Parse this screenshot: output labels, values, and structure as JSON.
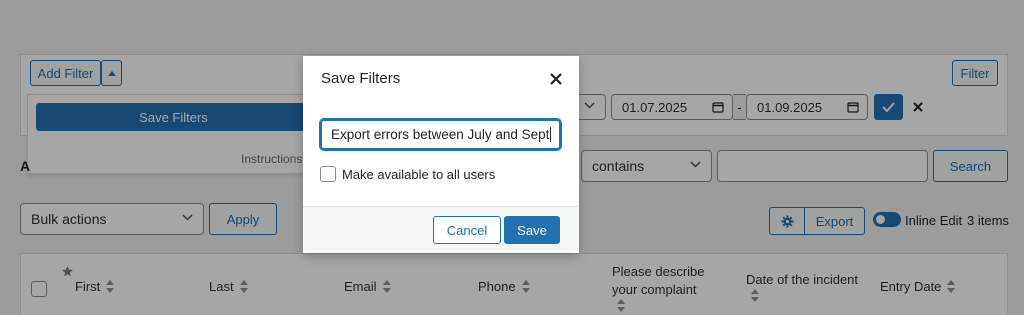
{
  "toolbar": {
    "add_filter_label": "Add Filter",
    "filter_label": "Filter",
    "save_filters_label": "Save Filters",
    "instructions_partial": "Instructions",
    "partial_letter": "A",
    "date_from": "01.07.2025",
    "date_to": "01.09.2025",
    "date_separator": "-"
  },
  "search": {
    "operator": "contains",
    "value": "",
    "button_label": "Search"
  },
  "bulk": {
    "select_value": "Bulk actions",
    "apply_label": "Apply",
    "export_label": "Export",
    "inline_edit_label": "Inline Edit",
    "items_count": "3 items"
  },
  "table": {
    "columns": [
      "First",
      "Last",
      "Email",
      "Phone",
      "Please describe your complaint",
      "Date of the incident",
      "Entry Date"
    ]
  },
  "modal": {
    "title": "Save Filters",
    "name_value": "Export errors between July and Sept",
    "checkbox_label": "Make available to all users",
    "cancel_label": "Cancel",
    "save_label": "Save"
  },
  "colors": {
    "accent": "#2271b1",
    "background": "#f0f0f1"
  }
}
